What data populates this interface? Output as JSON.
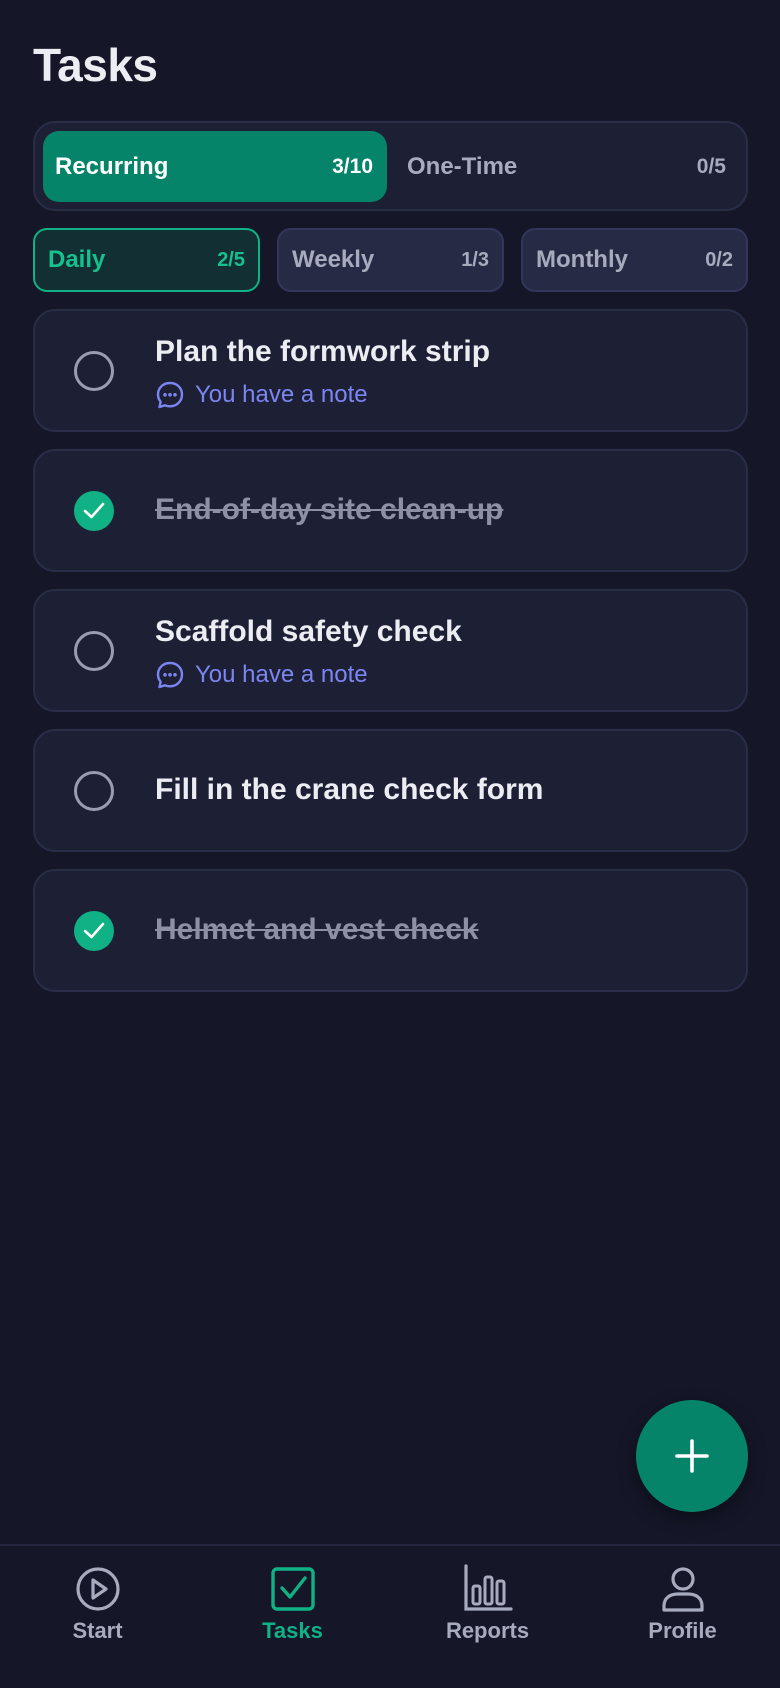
{
  "header": {
    "title": "Tasks"
  },
  "segments": [
    {
      "label": "Recurring",
      "count": "3/10",
      "active": true
    },
    {
      "label": "One-Time",
      "count": "0/5",
      "active": false
    }
  ],
  "frequency": [
    {
      "label": "Daily",
      "count": "2/5",
      "active": true
    },
    {
      "label": "Weekly",
      "count": "1/3",
      "active": false
    },
    {
      "label": "Monthly",
      "count": "0/2",
      "active": false
    }
  ],
  "tasks": [
    {
      "title": "Plan the formwork strip",
      "done": false,
      "note": "You have a note"
    },
    {
      "title": "End-of-day site clean-up",
      "done": true
    },
    {
      "title": "Scaffold safety check",
      "done": false,
      "note": "You have a note"
    },
    {
      "title": "Fill in the crane check form",
      "done": false
    },
    {
      "title": "Helmet and vest check",
      "done": true
    }
  ],
  "fab": {
    "icon": "plus-icon"
  },
  "nav": [
    {
      "label": "Start",
      "icon": "play-circle-icon",
      "active": false
    },
    {
      "label": "Tasks",
      "icon": "check-square-icon",
      "active": true
    },
    {
      "label": "Reports",
      "icon": "bar-chart-icon",
      "active": false
    },
    {
      "label": "Profile",
      "icon": "user-icon",
      "active": false
    }
  ],
  "colors": {
    "background": "#151729",
    "card": "#1D1F35",
    "accent": "#06846A",
    "accent_bright": "#10B185",
    "note": "#7C86F2",
    "muted": "#A8ABBE"
  }
}
